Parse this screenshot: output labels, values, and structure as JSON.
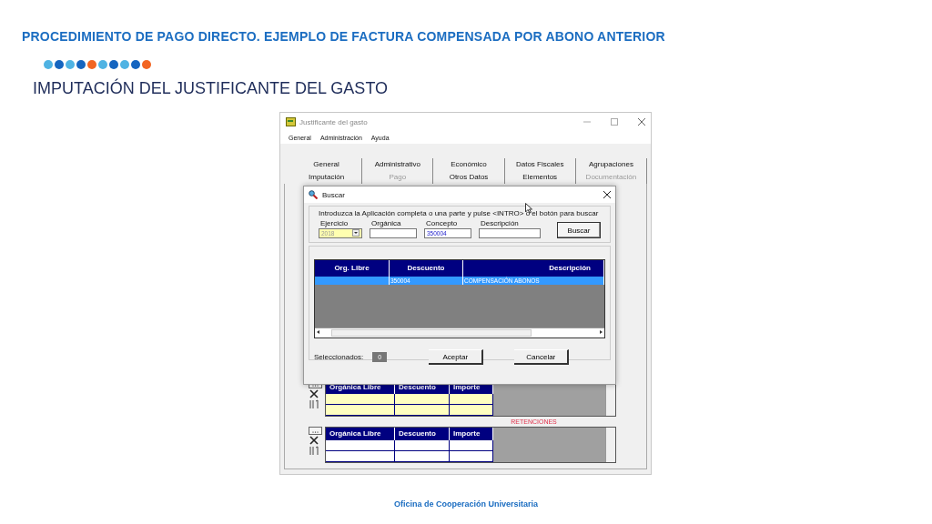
{
  "slide": {
    "title": "PROCEDIMIENTO DE PAGO DIRECTO. EJEMPLO DE FACTURA COMPENSADA POR ABONO ANTERIOR",
    "dots": [
      {
        "color": "#4fb3e3"
      },
      {
        "color": "#1565c0"
      },
      {
        "color": "#4fb3e3"
      },
      {
        "color": "#1565c0"
      },
      {
        "color": "#f26522"
      },
      {
        "color": "#4fb3e3"
      },
      {
        "color": "#1565c0"
      },
      {
        "color": "#4fb3e3"
      },
      {
        "color": "#1565c0"
      },
      {
        "color": "#f26522"
      }
    ],
    "subtitle": "IMPUTACIÓN DEL JUSTIFICANTE DEL GASTO",
    "footer": "Oficina de Cooperación Universitaria"
  },
  "window": {
    "title": "Justificante del gasto",
    "menu": [
      "General",
      "Administración",
      "Ayuda"
    ],
    "tab_rows": [
      [
        {
          "label": "General",
          "disabled": false
        },
        {
          "label": "Administrativo",
          "disabled": false
        },
        {
          "label": "Económico",
          "disabled": false
        },
        {
          "label": "Datos Fiscales",
          "disabled": false
        },
        {
          "label": "Agrupaciones",
          "disabled": false
        }
      ],
      [
        {
          "label": "Imputación",
          "disabled": false
        },
        {
          "label": "Pago",
          "disabled": true
        },
        {
          "label": "Otros Datos",
          "disabled": false
        },
        {
          "label": "Elementos",
          "disabled": false
        },
        {
          "label": "Documentación",
          "disabled": true
        }
      ]
    ],
    "grids": [
      {
        "kind": "highlighted",
        "columns": [
          "Orgánica Libre",
          "Descuento",
          "Importe"
        ]
      },
      {
        "kind": "plain",
        "label": "RETENCIONES",
        "columns": [
          "Orgánica Libre",
          "Descuento",
          "Importe"
        ]
      }
    ]
  },
  "dialog": {
    "title": "Buscar",
    "instruction": "Introduzca la Aplicación completa o una parte y pulse <INTRO> o el botón para buscar",
    "fields": [
      {
        "kind": "combo",
        "label": "Ejercicio",
        "value": "2018"
      },
      {
        "kind": "text",
        "label": "Orgánica"
      },
      {
        "kind": "text",
        "label": "Concepto",
        "value": "350004"
      },
      {
        "kind": "text",
        "label": "Descripción"
      }
    ],
    "search_button": "Buscar",
    "table": {
      "columns": [
        "Org. Libre",
        "Descuento",
        "Descripción"
      ],
      "rows": [
        {
          "cells": [
            "",
            "350004",
            "COMPENSACIÓN ABONOS"
          ],
          "selected": true
        }
      ]
    },
    "selected_label": "Seleccionados:",
    "selected_count": "0",
    "buttons": [
      "Aceptar",
      "Cancelar"
    ]
  }
}
